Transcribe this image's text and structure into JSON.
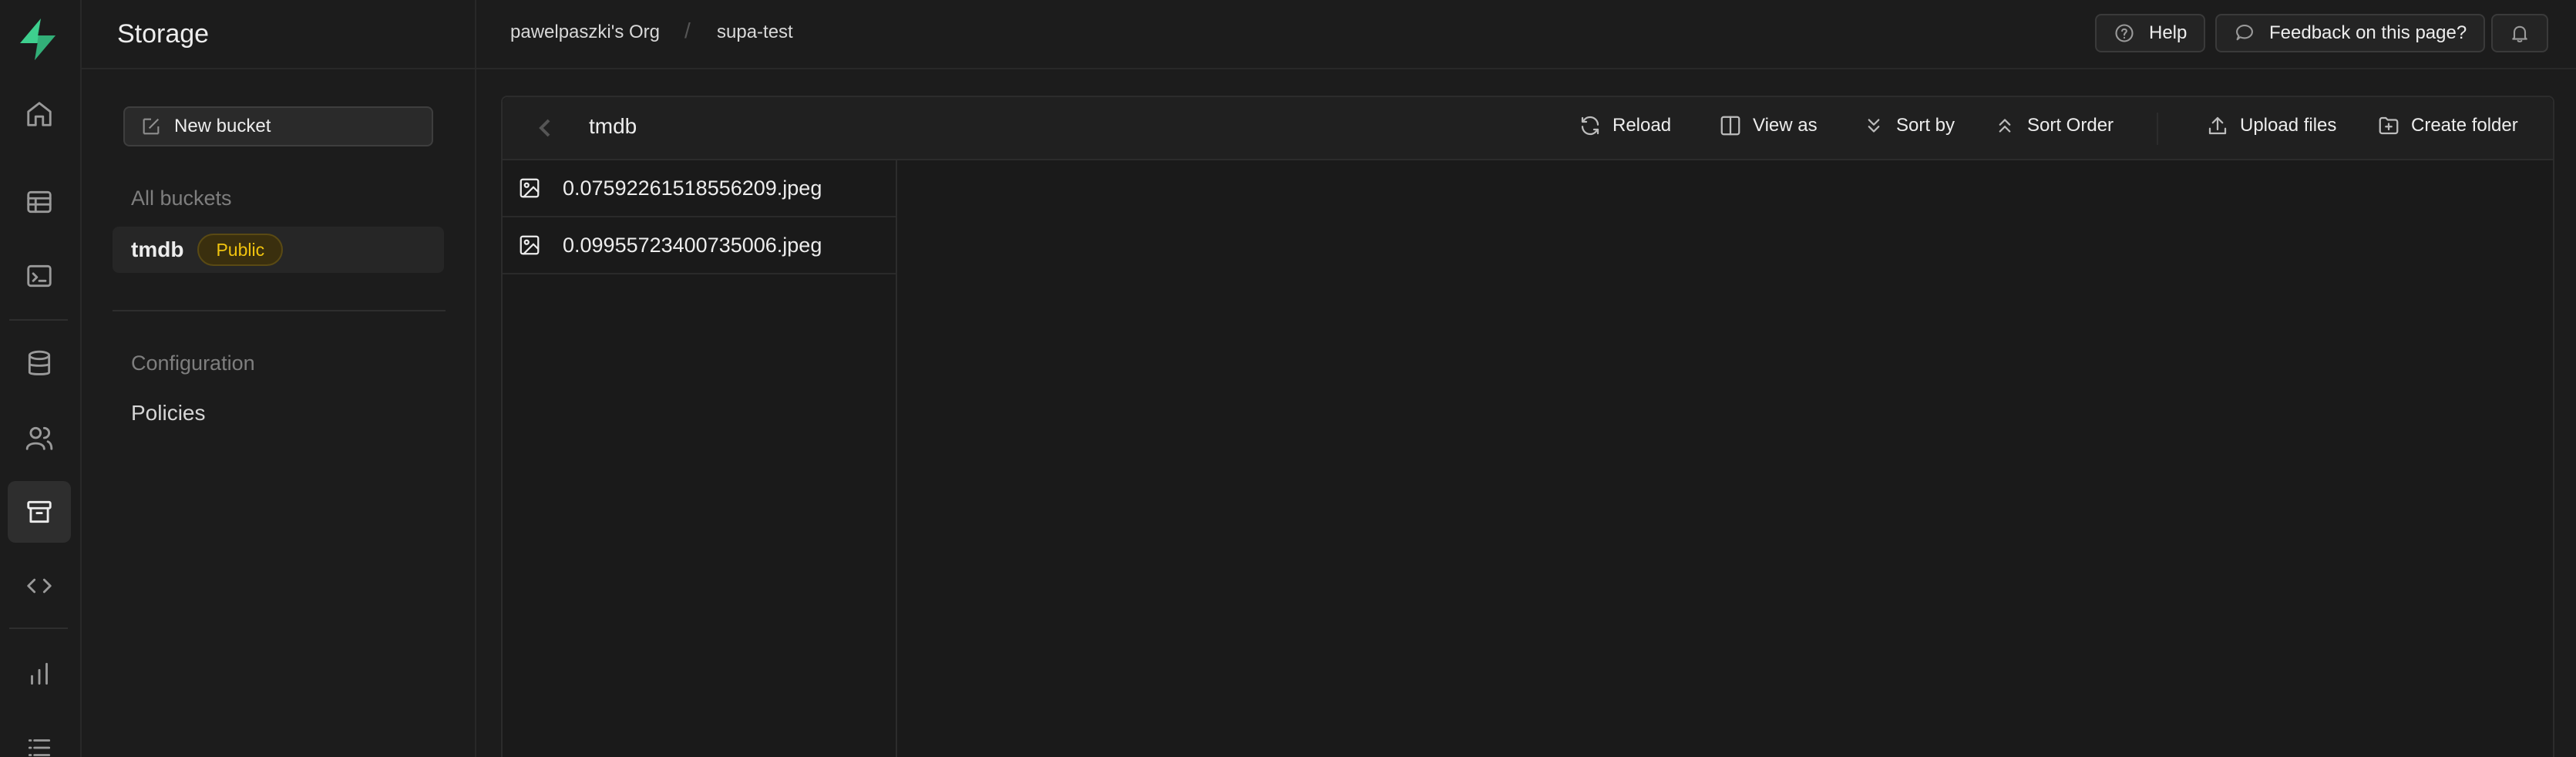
{
  "rail": {
    "items": [
      {
        "icon": "home-icon"
      },
      {
        "icon": "table-editor-icon"
      },
      {
        "icon": "sql-editor-icon"
      },
      {
        "icon": "database-icon"
      },
      {
        "icon": "users-icon"
      },
      {
        "icon": "storage-icon",
        "active": true
      },
      {
        "icon": "code-icon"
      },
      {
        "icon": "reports-icon"
      },
      {
        "icon": "logs-icon"
      }
    ]
  },
  "sidebar": {
    "title": "Storage",
    "new_bucket_label": "New bucket",
    "all_buckets_heading": "All buckets",
    "buckets": [
      {
        "name": "tmdb",
        "badge": "Public"
      }
    ],
    "configuration_heading": "Configuration",
    "policies_label": "Policies"
  },
  "topbar": {
    "org": "pawelpaszki's Org",
    "separator": "/",
    "project": "supa-test",
    "help_label": "Help",
    "feedback_label": "Feedback on this page?"
  },
  "explorer": {
    "bucket_title": "tmdb",
    "actions": {
      "reload": "Reload",
      "view_as": "View as",
      "sort_by": "Sort by",
      "sort_order": "Sort Order",
      "upload": "Upload files",
      "create_folder": "Create folder"
    },
    "files": [
      {
        "name": "0.07592261518556209.jpeg"
      },
      {
        "name": "0.09955723400735006.jpeg"
      }
    ]
  },
  "colors": {
    "background": "#1c1c1c",
    "brand": "#3ecf8e",
    "badge_text": "#f1c40f"
  }
}
